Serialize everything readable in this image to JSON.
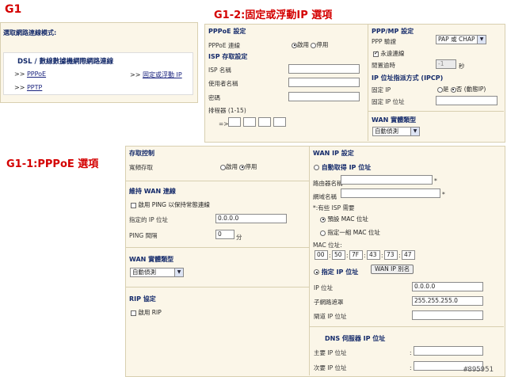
{
  "titles": {
    "g1": "G1",
    "g12": "G1-2:固定或浮動IP 選項",
    "g11": "G1-1:PPPoE 選項"
  },
  "g1": {
    "mode_heading": "選取網路連線模式:",
    "dsl_item": "DSL / 數線數據機網際網路連線",
    "pppoe_link": "PPPoE",
    "pptp_link": "PPTP",
    "static_link": "固定或浮動 IP",
    "bullet": ">>"
  },
  "g12": {
    "pppoe_settings": "PPPoE 設定",
    "pppoe_connect": "PPPoE 連線",
    "enable": "啟用",
    "disable": "停用",
    "isp_login": "ISP 存取設定",
    "isp_name": "ISP 名稱",
    "username": "使用者名稱",
    "password": "密碼",
    "sorter": "排程器 (1-15)",
    "sorter_arrow": "=>",
    "pppmp_settings": "PPP/MP 設定",
    "ppp_auth": "PPP 驗證",
    "ppp_auth_value": "PAP 或 CHAP",
    "always_on": "永遠連線",
    "idle_timeout": "閒置逾時",
    "idle_value": "-1",
    "idle_unit": "秒",
    "ip_assign": "IP 位址指派方式 (IPCP)",
    "fixed_ip": "固定 IP",
    "yes": "是",
    "no_dynamic": "否 (動態IP)",
    "fixed_ip_addr": "固定 IP 位址",
    "wan_type": "WAN 實體類型",
    "auto_detect": "自動偵測"
  },
  "g11": {
    "access_control": "存取控制",
    "broadband_access": "寬頻存取",
    "enable": "啟用",
    "disable": "停用",
    "keep_wan": "維持 WAN 連線",
    "ping_keep": "啟用 PING 以保持常態連線",
    "ping_ip": "指定的 IP 位址",
    "ping_ip_value": "0.0.0.0",
    "ping_interval": "PING 間隔",
    "ping_interval_value": "0",
    "minute": "分",
    "wan_type": "WAN 實體類型",
    "auto_detect": "自動偵測",
    "rip": "RIP 協定",
    "enable_rip": "啟用 RIP",
    "wan_ip_settings": "WAN IP 設定",
    "auto_ip": "自動取得 IP 位址",
    "router_name": "路由器名稱",
    "domain_name": "網域名稱",
    "star": "*",
    "isp_note": "*:有些 ISP 需要",
    "default_mac": "預設 MAC 位址",
    "specify_mac": "指定一組 MAC 位址",
    "mac_label": "MAC 位址:",
    "mac": [
      "00",
      "50",
      "7F",
      "43",
      "73",
      "47"
    ],
    "mac_sep": ":",
    "specify_ip": "指定 IP 位址",
    "wan_alias": "WAN IP 別名",
    "ip_addr": "IP 位址",
    "ip_addr_value": "0.0.0.0",
    "subnet": "子網路遮罩",
    "subnet_value": "255.255.255.0",
    "gateway": "閘道 IP 位址",
    "dns": "DNS 伺服器 IP 位址",
    "primary_dns": "主要 IP 位址",
    "secondary_dns": "次要 IP 位址",
    "colon": ":"
  },
  "watermark": "#895951"
}
